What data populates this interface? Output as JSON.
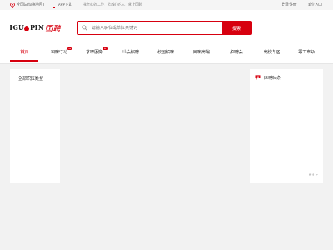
{
  "topbar": {
    "location": "全国站[切换地区]",
    "app_download": "APP下载",
    "slogan": "找放心的工作，找放心的人，就上国聘",
    "login": "登录/注册",
    "corp_entry": "单位入口"
  },
  "logo": {
    "en_left": "IGU",
    "en_right": "PIN",
    "cn": "国聘"
  },
  "search": {
    "placeholder": "请输入职位或单位关键词",
    "button": "搜索"
  },
  "nav": {
    "tabs": [
      {
        "label": "首页",
        "active": true,
        "badge": ""
      },
      {
        "label": "国聘行动",
        "active": false,
        "badge": "new"
      },
      {
        "label": "求职服务",
        "active": false,
        "badge": "hot"
      },
      {
        "label": "社会招聘",
        "active": false,
        "badge": ""
      },
      {
        "label": "校园招聘",
        "active": false,
        "badge": ""
      },
      {
        "label": "国聘高端",
        "active": false,
        "badge": ""
      },
      {
        "label": "招聘会",
        "active": false,
        "badge": ""
      },
      {
        "label": "高校专区",
        "active": false,
        "badge": ""
      },
      {
        "label": "零工市场",
        "active": false,
        "badge": ""
      }
    ]
  },
  "left_panel": {
    "title": "全部职位类型"
  },
  "right_panel": {
    "title": "国聘头条",
    "more": "更多 >"
  },
  "colors": {
    "brand_red": "#d7000f"
  }
}
